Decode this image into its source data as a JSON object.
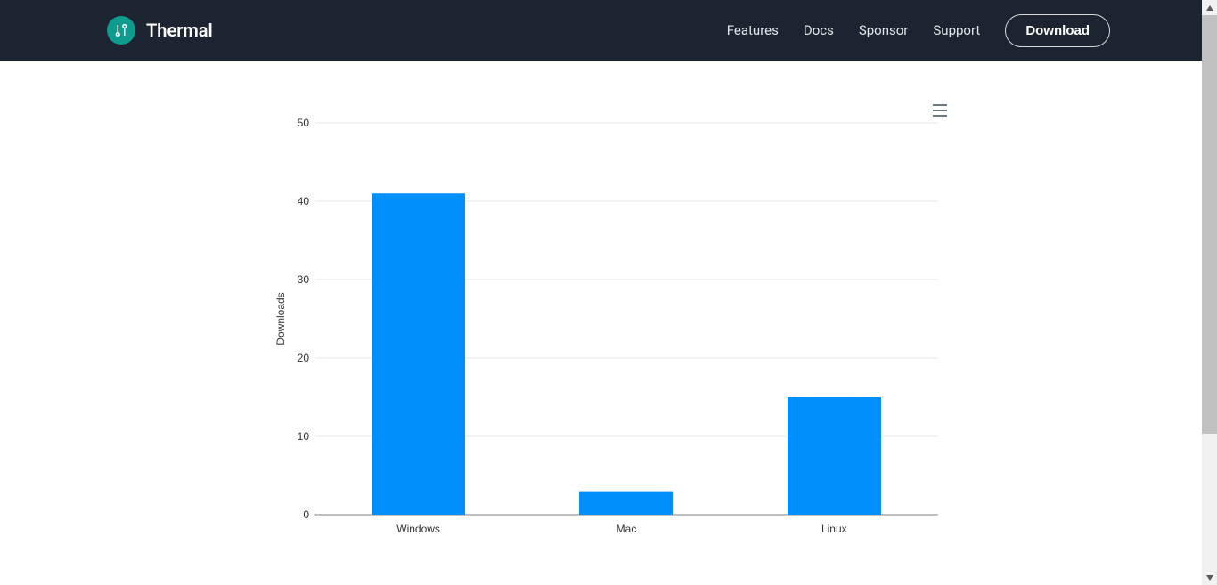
{
  "nav": {
    "brand": "Thermal",
    "links": [
      "Features",
      "Docs",
      "Sponsor",
      "Support"
    ],
    "download": "Download"
  },
  "chart_data": {
    "type": "bar",
    "categories": [
      "Windows",
      "Mac",
      "Linux"
    ],
    "values": [
      41,
      3,
      15
    ],
    "ylabel": "Downloads",
    "xlabel": "",
    "ylim": [
      0,
      50
    ],
    "yticks": [
      0,
      10,
      20,
      30,
      40,
      50
    ],
    "bar_color": "#008ffb"
  }
}
